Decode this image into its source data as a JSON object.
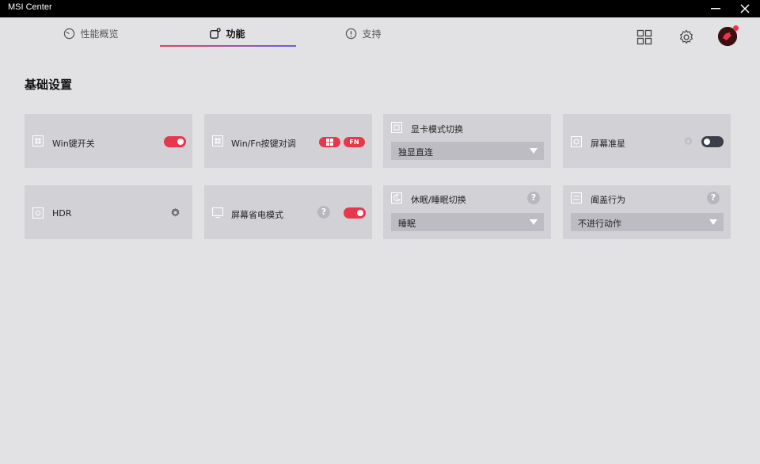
{
  "window": {
    "title": "MSI Center"
  },
  "tabs": [
    {
      "label": "性能概览",
      "icon": "gauge-icon"
    },
    {
      "label": "功能",
      "icon": "feature-icon",
      "active": true
    },
    {
      "label": "支持",
      "icon": "support-icon"
    }
  ],
  "section": {
    "title": "基础设置"
  },
  "cards": {
    "win_key": {
      "label": "Win键开关",
      "state": "on"
    },
    "win_fn_swap": {
      "label": "Win/Fn按键对调",
      "pill_fn": "FN"
    },
    "gpu_mode": {
      "label": "显卡模式切换",
      "value": "独显直连"
    },
    "screen_color": {
      "label": "屏幕准星",
      "state": "off"
    },
    "hdr": {
      "label": "HDR"
    },
    "screen_power": {
      "label": "屏幕省电模式",
      "help": "?",
      "state": "on"
    },
    "sleep_mode": {
      "label": "休眠/睡眠切换",
      "value": "睡眠",
      "help": "?"
    },
    "lid_action": {
      "label": "阖盖行为",
      "value": "不进行动作",
      "help": "?"
    }
  },
  "colors": {
    "accent": "#e8364d",
    "accent2": "#6b5cf0",
    "card": "#d2d2d6",
    "bg": "#e2e2e4"
  }
}
